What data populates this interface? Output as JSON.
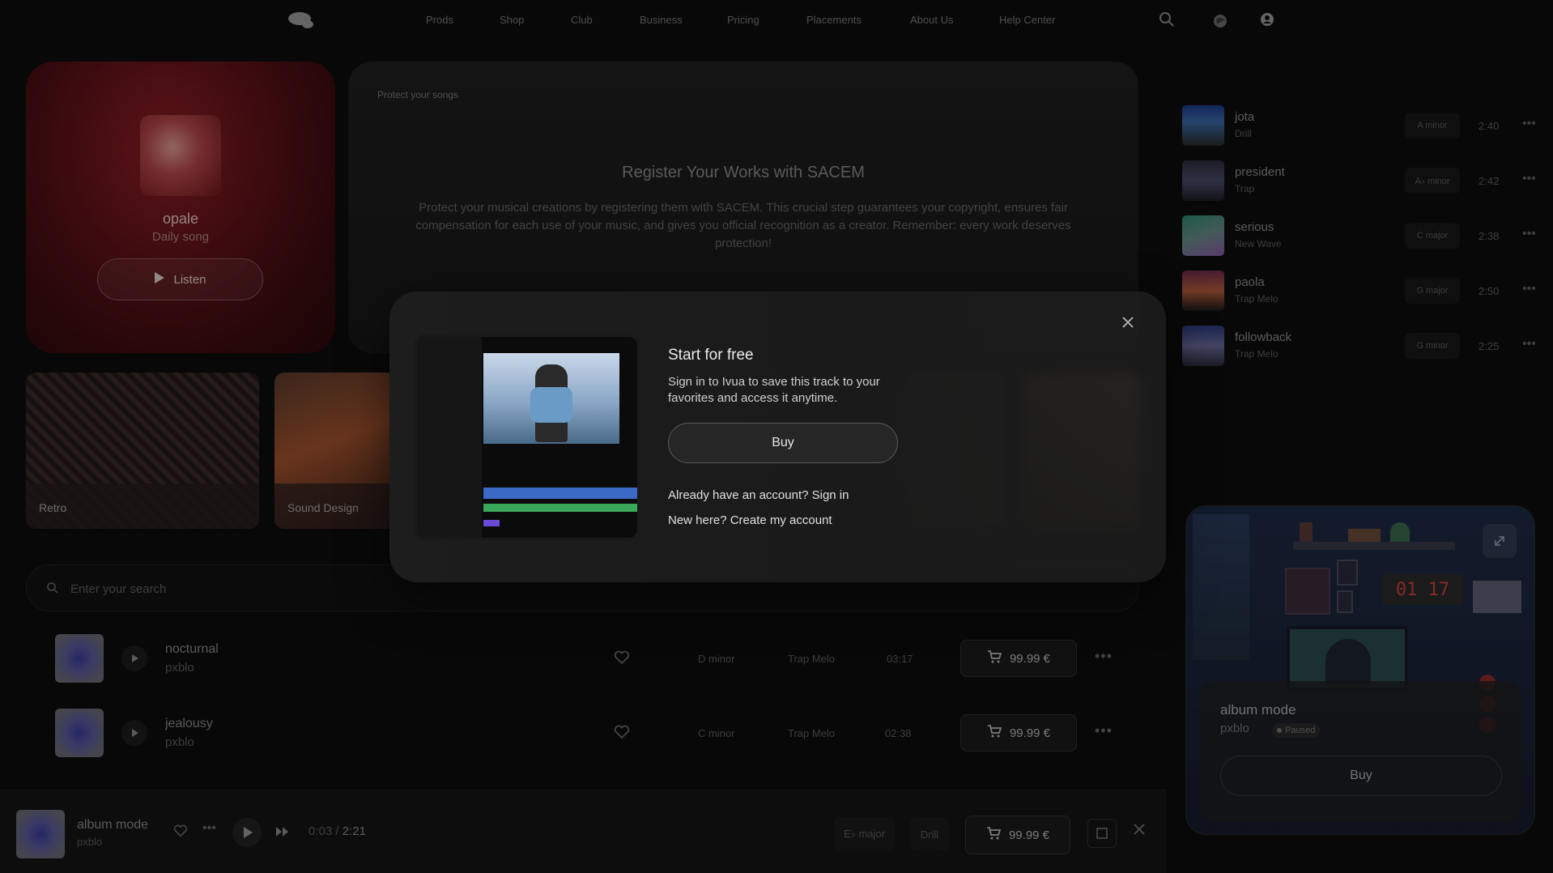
{
  "nav": {
    "links": [
      "Prods",
      "Shop",
      "Club",
      "Business",
      "Pricing",
      "Placements",
      "About Us",
      "Help Center"
    ]
  },
  "featured": {
    "title": "opale",
    "subtitle": "Daily song",
    "listen_label": "Listen"
  },
  "sacem": {
    "tag": "Protect your songs",
    "title": "Register Your Works with SACEM",
    "text": "Protect your musical creations by registering them with SACEM. This crucial step guarantees your copyright, ensures fair compensation for each use of your music, and gives you official recognition as a creator. Remember: every work deserves protection!"
  },
  "genres": [
    "Retro",
    "Sound Design"
  ],
  "search": {
    "placeholder": "Enter your search"
  },
  "tracks": [
    {
      "title": "nocturnal",
      "artist": "pxblo",
      "key": "D minor",
      "genre": "Trap Melo",
      "duration": "03:17",
      "price": "99.99 €"
    },
    {
      "title": "jealousy",
      "artist": "pxblo",
      "key": "C minor",
      "genre": "Trap Melo",
      "duration": "02:38",
      "price": "99.99 €"
    }
  ],
  "side_list": [
    {
      "title": "jota",
      "genre": "Drill",
      "key": "A minor",
      "duration": "2:40"
    },
    {
      "title": "president",
      "genre": "Trap",
      "key": "A♭ minor",
      "duration": "2:42"
    },
    {
      "title": "serious",
      "genre": "New Wave",
      "key": "C major",
      "duration": "2:38"
    },
    {
      "title": "paola",
      "genre": "Trap Melo",
      "key": "G major",
      "duration": "2:50"
    },
    {
      "title": "followback",
      "genre": "Trap Melo",
      "key": "G minor",
      "duration": "2:25"
    }
  ],
  "player_card": {
    "clock": "01 17",
    "title": "album mode",
    "artist": "pxblo",
    "status": "Paused",
    "buy_label": "Buy"
  },
  "bottom_player": {
    "title": "album mode",
    "artist": "pxblo",
    "current_time": "0:03",
    "separator": "/",
    "total_time": "2:21",
    "key": "E♭ major",
    "genre": "Drill",
    "price": "99.99 €"
  },
  "modal": {
    "title": "Start for free",
    "text": "Sign in to Ivua to save this track to your favorites and access it anytime.",
    "buy_label": "Buy",
    "signin_text": "Already have an account? Sign in",
    "signup_text": "New here? Create my account"
  },
  "colors": {
    "background": "#0d0d0d",
    "accent_red": "#8e1e25",
    "modal_bg": "#1d1d1d"
  }
}
